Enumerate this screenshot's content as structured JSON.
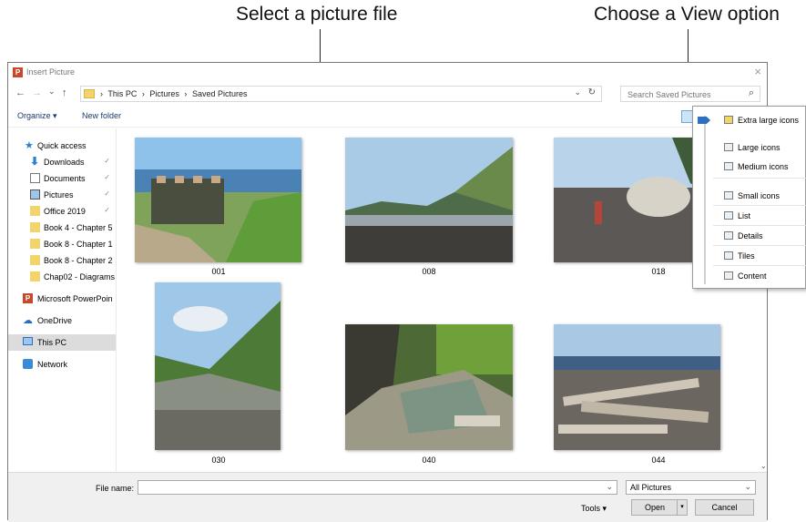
{
  "callouts": {
    "left": "Select a picture file",
    "right": "Choose a View option"
  },
  "dialog": {
    "title": "Insert Picture",
    "close_glyph": "×"
  },
  "nav": {
    "back": "←",
    "forward": "→",
    "recent": "⌄",
    "up": "↑",
    "breadcrumb": [
      "›",
      "This PC",
      "›",
      "Pictures",
      "›",
      "Saved Pictures"
    ],
    "address_dropdown": "⌄",
    "refresh": "↻",
    "search_placeholder": "Search Saved Pictures",
    "search_icon": "⌕"
  },
  "toolbar": {
    "organize": "Organize ▾",
    "new_folder": "New folder"
  },
  "sidebar": {
    "items": [
      {
        "label": "Quick access",
        "icon": "star-icon",
        "pin": ""
      },
      {
        "label": "Downloads",
        "icon": "download-icon",
        "pin": "📌"
      },
      {
        "label": "Documents",
        "icon": "document-icon",
        "pin": "📌"
      },
      {
        "label": "Pictures",
        "icon": "pictures-icon",
        "pin": "📌"
      },
      {
        "label": "Office 2019",
        "icon": "folder-icon",
        "pin": "📌"
      },
      {
        "label": "Book 4 - Chapter 5",
        "icon": "folder-icon",
        "pin": ""
      },
      {
        "label": "Book 8 - Chapter 1",
        "icon": "folder-icon",
        "pin": ""
      },
      {
        "label": "Book 8 - Chapter 2",
        "icon": "folder-icon",
        "pin": ""
      },
      {
        "label": "Chap02 - Diagrams",
        "icon": "folder-icon",
        "pin": ""
      },
      {
        "label": "Microsoft PowerPoin",
        "icon": "powerpoint-icon",
        "pin": ""
      },
      {
        "label": "OneDrive",
        "icon": "cloud-icon",
        "pin": ""
      },
      {
        "label": "This PC",
        "icon": "computer-icon",
        "pin": ""
      },
      {
        "label": "Network",
        "icon": "network-icon",
        "pin": ""
      }
    ]
  },
  "files": [
    {
      "name": "001"
    },
    {
      "name": "008"
    },
    {
      "name": "018"
    },
    {
      "name": "030"
    },
    {
      "name": "040"
    },
    {
      "name": "044"
    }
  ],
  "view_menu": {
    "items": [
      "Extra large icons",
      "Large icons",
      "Medium icons",
      "Small icons",
      "List",
      "Details",
      "Tiles",
      "Content"
    ]
  },
  "footer": {
    "file_name_label": "File name:",
    "file_name_value": "",
    "filter": "All Pictures",
    "dropdown": "⌄",
    "tools": "Tools ▾",
    "open": "Open",
    "open_split": "▾",
    "cancel": "Cancel"
  },
  "colors": {
    "accent": "#2f6fc1",
    "selected_nav": "#dcdcdc",
    "folder": "#f3d36b"
  }
}
